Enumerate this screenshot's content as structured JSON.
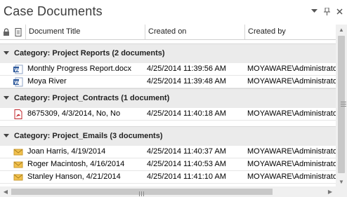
{
  "panel": {
    "title": "Case Documents",
    "buttons": {
      "menu": "▾",
      "pin": "⊥",
      "close": "×"
    }
  },
  "columns": {
    "lock_icon": "lock-icon",
    "page_icon": "document-icon",
    "title": "Document Title",
    "created_on": "Created on",
    "created_by": "Created by"
  },
  "groups": [
    {
      "label": "Category: Project Reports (2 documents)",
      "rows": [
        {
          "icon": "word-doc-icon",
          "title": "Monthly Progress Report.docx",
          "created_on": "4/25/2014 11:39:56 AM",
          "created_by": "MOYAWARE\\Administrator"
        },
        {
          "icon": "word-doc-icon",
          "title": "Moya River",
          "created_on": "4/25/2014 11:39:48 AM",
          "created_by": "MOYAWARE\\Administrator"
        }
      ]
    },
    {
      "label": "Category: Project_Contracts (1 document)",
      "rows": [
        {
          "icon": "pdf-icon",
          "title": "8675309, 4/3/2014, No, No",
          "created_on": "4/25/2014 11:40:18 AM",
          "created_by": "MOYAWARE\\Administrator"
        }
      ]
    },
    {
      "label": "Category: Project_Emails (3 documents)",
      "rows": [
        {
          "icon": "email-icon",
          "title": "Joan Harris, 4/19/2014",
          "created_on": "4/25/2014 11:40:37 AM",
          "created_by": "MOYAWARE\\Administrator"
        },
        {
          "icon": "email-icon",
          "title": "Roger Macintosh, 4/16/2014",
          "created_on": "4/25/2014 11:40:53 AM",
          "created_by": "MOYAWARE\\Administrator"
        },
        {
          "icon": "email-icon",
          "title": "Stanley Hanson, 4/21/2014",
          "created_on": "4/25/2014 11:41:10 AM",
          "created_by": "MOYAWARE\\Administrator"
        }
      ]
    }
  ],
  "colors": {
    "category_bg": "#ebebeb",
    "word_blue": "#2b579a",
    "pdf_red": "#c1272d",
    "email_yellow": "#f2c14e"
  }
}
